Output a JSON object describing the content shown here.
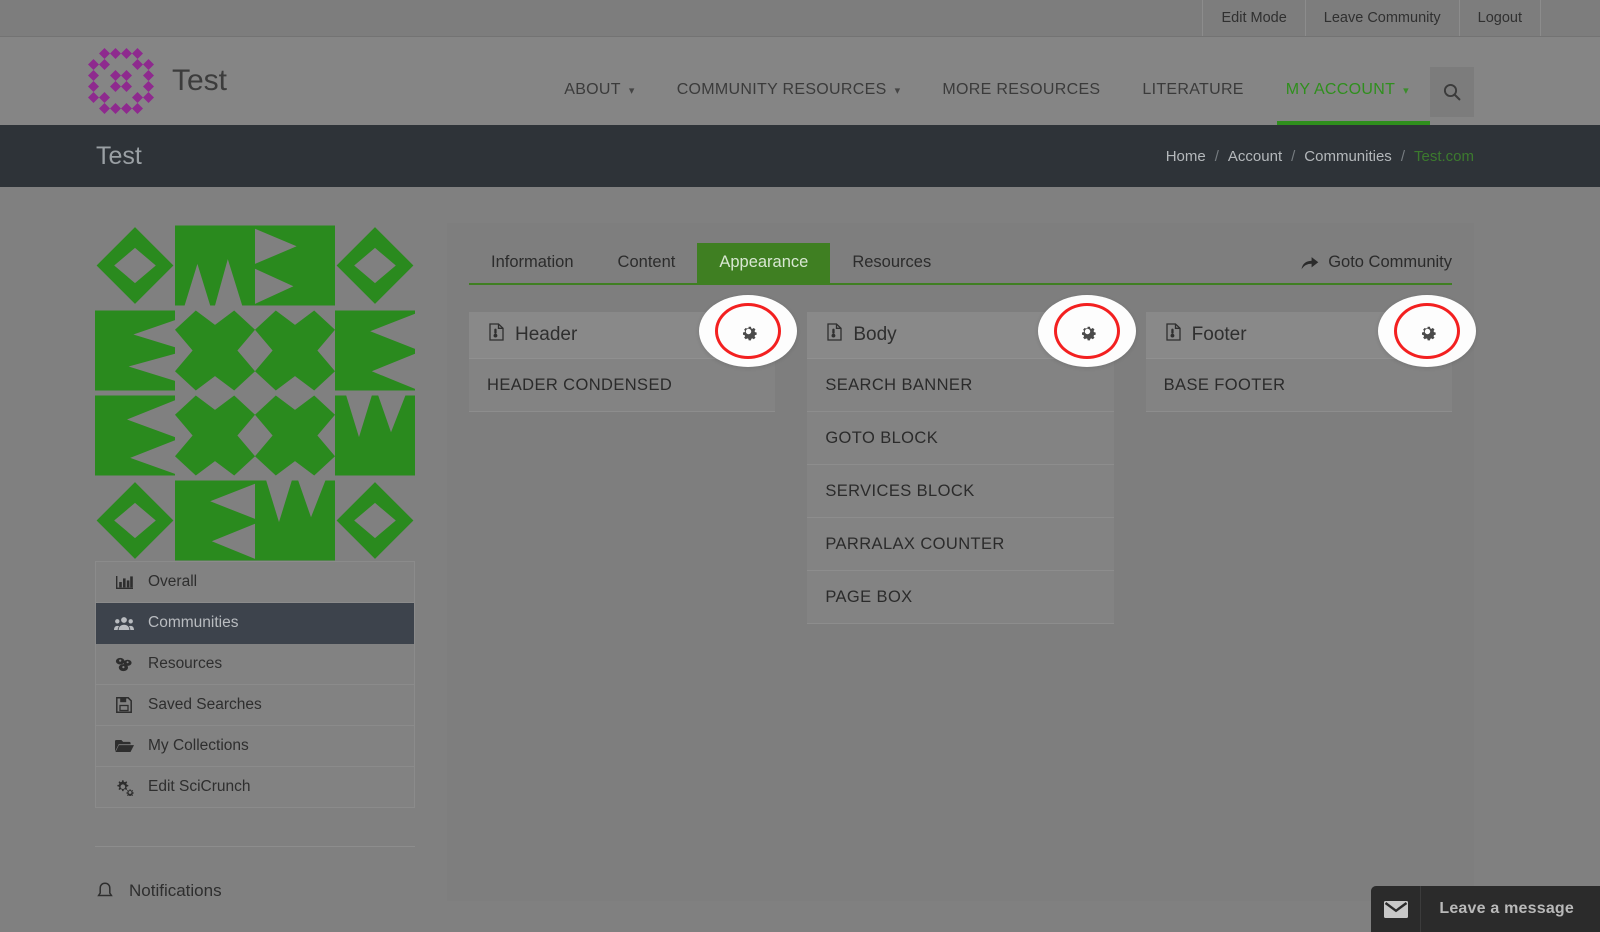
{
  "utility_bar": {
    "items": [
      {
        "label": "Edit Mode"
      },
      {
        "label": "Leave Community"
      },
      {
        "label": "Logout"
      }
    ]
  },
  "header": {
    "brand_name": "Test",
    "logo_icon": "purple-identicon-logo",
    "search_icon": "search-icon",
    "nav": [
      {
        "label": "ABOUT",
        "has_caret": true,
        "active": false
      },
      {
        "label": "COMMUNITY RESOURCES",
        "has_caret": true,
        "active": false
      },
      {
        "label": "MORE RESOURCES",
        "has_caret": false,
        "active": false
      },
      {
        "label": "LITERATURE",
        "has_caret": false,
        "active": false
      },
      {
        "label": "MY ACCOUNT",
        "has_caret": true,
        "active": true
      }
    ]
  },
  "title_band": {
    "title": "Test",
    "breadcrumb": [
      {
        "label": "Home",
        "current": false
      },
      {
        "label": "Account",
        "current": false
      },
      {
        "label": "Communities",
        "current": false
      },
      {
        "label": "Test.com",
        "current": true
      }
    ],
    "separator": "/"
  },
  "sidebar": {
    "community_logo_icon": "green-identicon-logo",
    "items": [
      {
        "label": "Overall",
        "icon": "bar-chart-icon",
        "active": false
      },
      {
        "label": "Communities",
        "icon": "users-icon",
        "active": true
      },
      {
        "label": "Resources",
        "icon": "cubes-icon",
        "active": false
      },
      {
        "label": "Saved Searches",
        "icon": "floppy-disk-icon",
        "active": false
      },
      {
        "label": "My Collections",
        "icon": "folder-open-icon",
        "active": false
      },
      {
        "label": "Edit SciCrunch",
        "icon": "gears-icon",
        "active": false
      }
    ],
    "notifications_label": "Notifications",
    "notifications_icon": "bell-icon"
  },
  "main": {
    "tabs": [
      {
        "label": "Information",
        "active": false
      },
      {
        "label": "Content",
        "active": false
      },
      {
        "label": "Appearance",
        "active": true
      },
      {
        "label": "Resources",
        "active": false
      }
    ],
    "goto_community": {
      "label": "Goto Community",
      "icon": "share-arrow-icon"
    },
    "panels": [
      {
        "title": "Header",
        "icon": "file-template-icon",
        "gear_icon": "gear-icon",
        "items": [
          "HEADER CONDENSED"
        ]
      },
      {
        "title": "Body",
        "icon": "file-template-icon",
        "gear_icon": "gear-icon",
        "items": [
          "SEARCH BANNER",
          "GOTO BLOCK",
          "SERVICES BLOCK",
          "PARRALAX COUNTER",
          "PAGE BOX"
        ]
      },
      {
        "title": "Footer",
        "icon": "file-template-icon",
        "gear_icon": "gear-icon",
        "items": [
          "BASE FOOTER"
        ]
      }
    ]
  },
  "chat_widget": {
    "label": "Leave a message",
    "icon": "envelope-icon"
  },
  "colors": {
    "accent_green": "#2f8f1d",
    "tab_active_green": "#3f7f22",
    "highlight_red": "#f32020",
    "dark_band": "#2e3338",
    "sidebar_active": "#3d434c",
    "brand_purple": "#8e2a8e",
    "community_green": "#2a8a1e"
  }
}
